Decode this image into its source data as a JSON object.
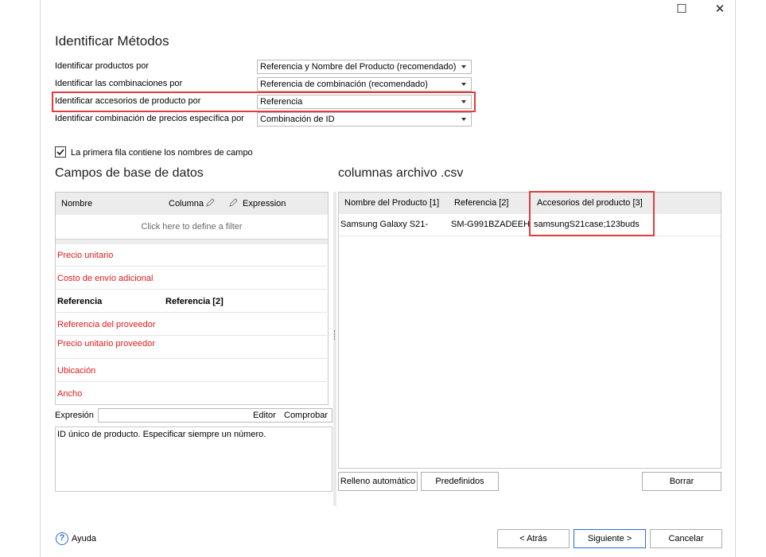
{
  "window": {
    "maximize_glyph": "☐",
    "close_glyph": "✕"
  },
  "title": "Identificar Métodos",
  "identify_rows": [
    {
      "label": "Identificar productos por",
      "value": "Referencia y Nombre del Producto (recomendado)"
    },
    {
      "label": "Identificar las combinaciones por",
      "value": "Referencia de combinación (recomendado)"
    },
    {
      "label": "Identificar accesorios de producto por",
      "value": "Referencia"
    },
    {
      "label": "Identificar combinación de precios específica por",
      "value": "Combinación de ID"
    }
  ],
  "first_row_checkbox": {
    "label": "La primera fila contiene los nombres de campo",
    "checked": true
  },
  "db_fields": {
    "section_title": "Campos de base de datos",
    "headers": {
      "name": "Nombre",
      "column": "Columna",
      "expression": "Expression"
    },
    "filter_placeholder": "Click here to define a filter",
    "rows": [
      {
        "name": "Precio unitario",
        "column": ""
      },
      {
        "name": "Costo de envío adicional",
        "column": ""
      },
      {
        "name": "Referencia",
        "column": "Referencia [2]"
      },
      {
        "name": "Referencia del proveedor",
        "column": ""
      },
      {
        "name": "Precio unitario proveedor",
        "column": ""
      },
      {
        "name": "Ubicación",
        "column": ""
      },
      {
        "name": "Ancho",
        "column": ""
      }
    ]
  },
  "expression": {
    "label": "Expresión",
    "value": "",
    "editor_label": "Editor",
    "check_label": "Comprobar",
    "description": "ID único de producto. Especificar siempre un número."
  },
  "csv": {
    "section_title": "columnas archivo .csv",
    "headers": [
      "Nombre del Producto [1]",
      "Referencia [2]",
      "Accesorios del producto [3]"
    ],
    "rows": [
      [
        "Samsung Galaxy S21-",
        "SM-G991BZADEEH",
        "samsungS21case;123buds"
      ]
    ]
  },
  "buttons": {
    "autofill": "Relleno automático",
    "predefined": "Predefinidos",
    "clear": "Borrar",
    "help": "Ayuda",
    "back": "< Atrás",
    "next": "Siguiente >",
    "cancel": "Cancelar"
  },
  "colors": {
    "highlight": "#e23c3c",
    "required_field": "#e01b1b",
    "help_icon": "#2a6fd1"
  }
}
